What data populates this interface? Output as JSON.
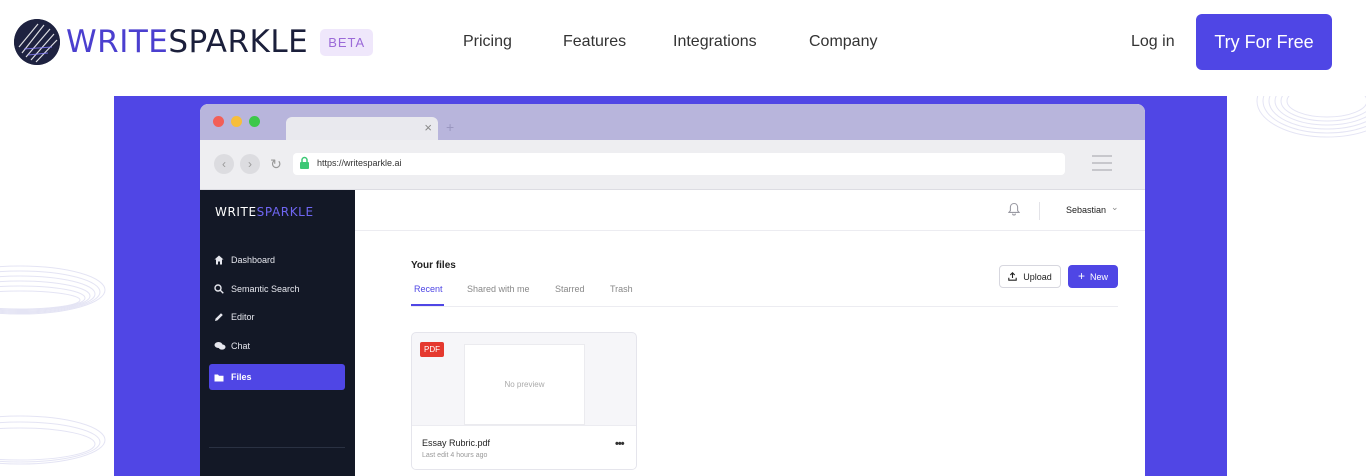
{
  "site": {
    "brand_first": "WRITE",
    "brand_second": "SPARKLE",
    "badge": "BETA",
    "nav": [
      "Pricing",
      "Features",
      "Integrations",
      "Company"
    ],
    "login": "Log in",
    "cta": "Try For Free"
  },
  "colors": {
    "accent": "#4f46e5",
    "band": "#5046e5",
    "sidebar": "#131826",
    "pdf": "#e5392f"
  },
  "browser": {
    "url": "https://writesparkle.ai",
    "tab_close": "×",
    "tab_new": "+"
  },
  "app": {
    "brand_first": "WRITE",
    "brand_second": "SPARKLE",
    "sidebar": [
      {
        "label": "Dashboard",
        "icon": "home-icon"
      },
      {
        "label": "Semantic Search",
        "icon": "search-icon"
      },
      {
        "label": "Editor",
        "icon": "pencil-icon"
      },
      {
        "label": "Chat",
        "icon": "chat-icon"
      },
      {
        "label": "Files",
        "icon": "folder-icon",
        "active": true
      }
    ],
    "user": "Sebastian",
    "files": {
      "title": "Your files",
      "tabs": [
        "Recent",
        "Shared with me",
        "Starred",
        "Trash"
      ],
      "active_tab": "Recent",
      "upload": "Upload",
      "new": "New",
      "items": [
        {
          "type": "PDF",
          "preview": "No preview",
          "name": "Essay Rubric.pdf",
          "meta": "Last edit 4 hours ago",
          "more": "•••"
        }
      ]
    }
  }
}
